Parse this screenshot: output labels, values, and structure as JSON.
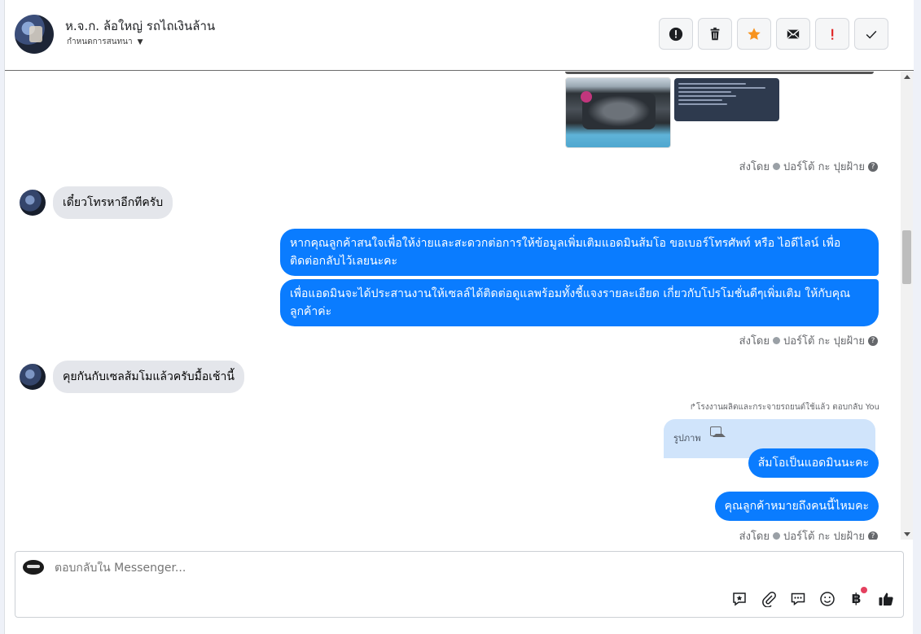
{
  "header": {
    "title": "ห.จ.ก. ล้อใหญ่ รถไถเงินล้าน",
    "subtitle": "กำหนดการสนทนา",
    "actions": [
      {
        "name": "report-icon"
      },
      {
        "name": "trash-icon"
      },
      {
        "name": "star-icon",
        "color": "#f7931e"
      },
      {
        "name": "mail-icon"
      },
      {
        "name": "important-icon",
        "color": "#e02424"
      },
      {
        "name": "check-icon"
      }
    ]
  },
  "messages": {
    "sent_by_label": "ส่งโดย",
    "sender_name": "ปอร์โต้ กะ ปุยฝ้าย",
    "incoming_1": "เดี๋ยวโทรหาอีกทีครับ",
    "outgoing_1": "หากคุณลูกค้าสนใจเพื่อให้ง่ายและสะดวกต่อการให้ข้อมูลเพิ่มเติมแอดมินส้มโอ ขอเบอร์โทรศัพท์ หรือ ไอดีไลน์ เพื่อติดต่อกลับไว้เลยนะคะ",
    "outgoing_2": "เพื่อแอดมินจะได้ประสานงานให้เซลล์ได้ติดต่อดูแลพร้อมทั้งชี้แจงรายละเอียด เกี่ยวกับโปรโมชั่นดีๆเพิ่มเติม ให้กับคุณลูกค้าค่ะ",
    "incoming_2": "คุยกันกับเซลส้มโมแล้วครับมื้อเช้านี้",
    "reply_note": "↱โรงงานผลิตและกระจายรถยนต์ใช้แล้ว ตอบกลับ You",
    "reply_preview_label": "รูปภาพ",
    "outgoing_3": "ส้มโอเป็นแอดมินนะคะ",
    "outgoing_4": "คุณลูกค้าหมายถึงคนนี้ไหมคะ"
  },
  "composer": {
    "placeholder": "ตอบกลับใน Messenger...",
    "tools": [
      "saved-reply-icon",
      "attach-icon",
      "chat-bubble-icon",
      "emoji-icon",
      "payment-baht-icon",
      "thumbs-up-icon"
    ]
  },
  "colors": {
    "outgoing_bubble": "#0a7cff",
    "incoming_bubble": "#e4e6eb",
    "reply_preview": "#d0e4fb"
  }
}
